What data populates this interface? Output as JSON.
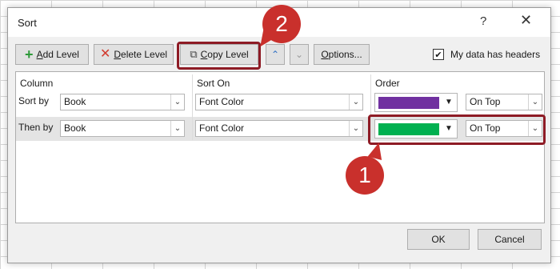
{
  "dialog": {
    "title": "Sort",
    "help_label": "?",
    "close_label": "✕"
  },
  "toolbar": {
    "add_level": {
      "icon": "plus-icon",
      "prefix": "",
      "key": "A",
      "rest": "dd Level"
    },
    "delete_level": {
      "icon": "delete-x-icon",
      "prefix": "",
      "key": "D",
      "rest": "elete Level"
    },
    "copy_level": {
      "icon": "copy-icon",
      "prefix": "",
      "key": "C",
      "rest": "opy Level"
    },
    "move_up_glyph": "⌃",
    "move_down_glyph": "⌄",
    "options": {
      "key": "O",
      "rest": "ptions..."
    },
    "headers_checkbox": {
      "checked": "✔",
      "label": "My data has headers"
    }
  },
  "grid": {
    "headers": {
      "column": "Column",
      "sort_on": "Sort On",
      "order": "Order"
    },
    "rows": [
      {
        "label": "Sort by",
        "column": "Book",
        "sort_on": "Font Color",
        "color": "#7030a0",
        "position": "On Top"
      },
      {
        "label": "Then by",
        "column": "Book",
        "sort_on": "Font Color",
        "color": "#00b050",
        "position": "On Top"
      }
    ]
  },
  "footer": {
    "ok": "OK",
    "cancel": "Cancel"
  },
  "annotations": {
    "marker_1": "1",
    "marker_2": "2",
    "color": "#c9302c"
  },
  "glyphs": {
    "dropdown": "⌄",
    "dropdown_solid": "▼"
  }
}
